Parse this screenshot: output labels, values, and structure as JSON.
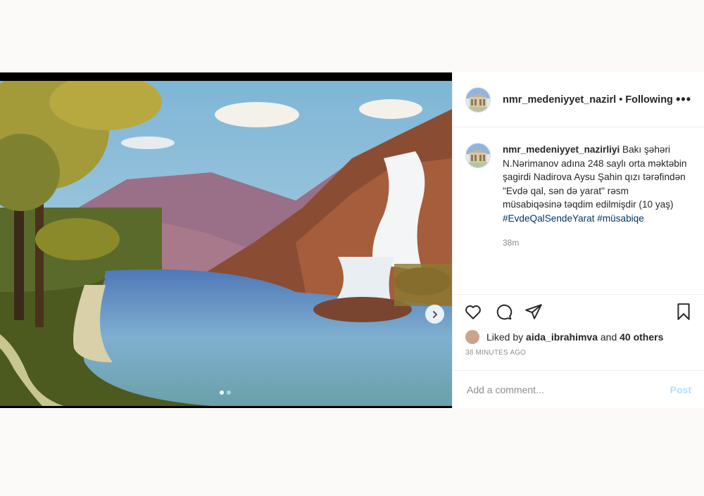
{
  "header": {
    "username": "nmr_medeniyyet_nazirl",
    "separator": "•",
    "follow_status": "Following",
    "more_label": "•••"
  },
  "caption": {
    "username": "nmr_medeniyyet_nazirliyi",
    "text": "Bakı şəhəri N.Nərimanov adına 248 saylı orta məktəbin şagirdi Nadirova Aysu Şahin qızı tərəfindən \"Evdə qal, sən də yarat\" rəsm müsabiqəsinə təqdim edilmişdir (10 yaş)",
    "hashtag1": "#EvdeQalSendeYarat",
    "hashtag2": "#müsabiqe",
    "time_ago": "38m"
  },
  "likes": {
    "prefix": "Liked by",
    "user": "aida_ibrahimva",
    "middle": "and",
    "others": "40 others"
  },
  "posted": "38 MINUTES AGO",
  "comment": {
    "placeholder": "Add a comment...",
    "post_label": "Post"
  },
  "carousel": {
    "count": 2,
    "active_index": 0
  },
  "icons": {
    "like": "heart-icon",
    "comment": "comment-icon",
    "share": "share-icon",
    "save": "bookmark-icon",
    "next": "chevron-right-icon"
  }
}
